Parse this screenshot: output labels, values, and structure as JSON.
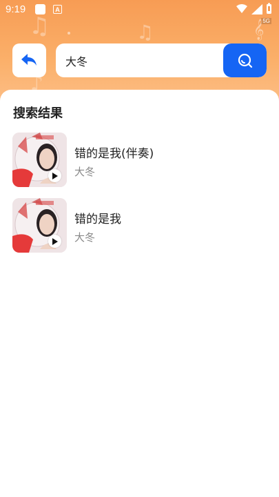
{
  "status_bar": {
    "time": "9:19",
    "a_badge": "A",
    "network_label": "5G"
  },
  "header": {
    "back_icon": "back-arrow-icon",
    "search": {
      "value": "大冬",
      "button_icon": "search-icon"
    }
  },
  "results": {
    "title": "搜索结果",
    "items": [
      {
        "title": "错的是我(伴奏)",
        "artist": "大冬",
        "icon": "play-icon"
      },
      {
        "title": "错的是我",
        "artist": "大冬",
        "icon": "play-icon"
      }
    ]
  },
  "colors": {
    "header_gradient_top": "#f79c54",
    "header_gradient_bottom": "#fcc08a",
    "accent": "#1565f4",
    "back_icon": "#1565f4",
    "artist_text": "#888888"
  }
}
